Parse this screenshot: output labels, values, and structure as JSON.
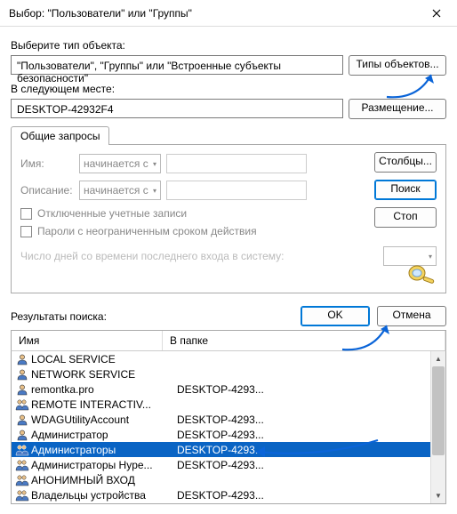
{
  "titlebar": {
    "title": "Выбор: \"Пользователи\" или \"Группы\""
  },
  "objectType": {
    "label": "Выберите тип объекта:",
    "value": "\"Пользователи\", \"Группы\" или \"Встроенные субъекты безопасности\"",
    "button": "Типы объектов..."
  },
  "location": {
    "label": "В следующем месте:",
    "value": "DESKTOP-42932F4",
    "button": "Размещение..."
  },
  "queries": {
    "tab": "Общие запросы",
    "nameLabel": "Имя:",
    "descLabel": "Описание:",
    "starts": "начинается с",
    "cb_disabled": "Отключенные учетные записи",
    "cb_pwnoexpire": "Пароли с неограниченным сроком действия",
    "daysLabel": "Число дней со времени последнего входа в систему:",
    "btn_columns": "Столбцы...",
    "btn_search": "Поиск",
    "btn_stop": "Стоп"
  },
  "actions": {
    "resultsLabel": "Результаты поиска:",
    "ok": "OK",
    "cancel": "Отмена"
  },
  "results": {
    "col_name": "Имя",
    "col_folder": "В папке",
    "rows": [
      {
        "icon": "user",
        "name": "LOCAL SERVICE",
        "folder": ""
      },
      {
        "icon": "user",
        "name": "NETWORK SERVICE",
        "folder": ""
      },
      {
        "icon": "user",
        "name": "remontka.pro",
        "folder": "DESKTOP-4293..."
      },
      {
        "icon": "group",
        "name": "REMOTE INTERACTIV...",
        "folder": ""
      },
      {
        "icon": "user",
        "name": "WDAGUtilityAccount",
        "folder": "DESKTOP-4293..."
      },
      {
        "icon": "user",
        "name": "Администратор",
        "folder": "DESKTOP-4293..."
      },
      {
        "icon": "group",
        "name": "Администраторы",
        "folder": "DESKTOP-4293...",
        "selected": true
      },
      {
        "icon": "group",
        "name": "Администраторы Hype...",
        "folder": "DESKTOP-4293..."
      },
      {
        "icon": "group",
        "name": "АНОНИМНЫЙ ВХОД",
        "folder": ""
      },
      {
        "icon": "group",
        "name": "Владельцы устройства",
        "folder": "DESKTOP-4293..."
      }
    ]
  }
}
